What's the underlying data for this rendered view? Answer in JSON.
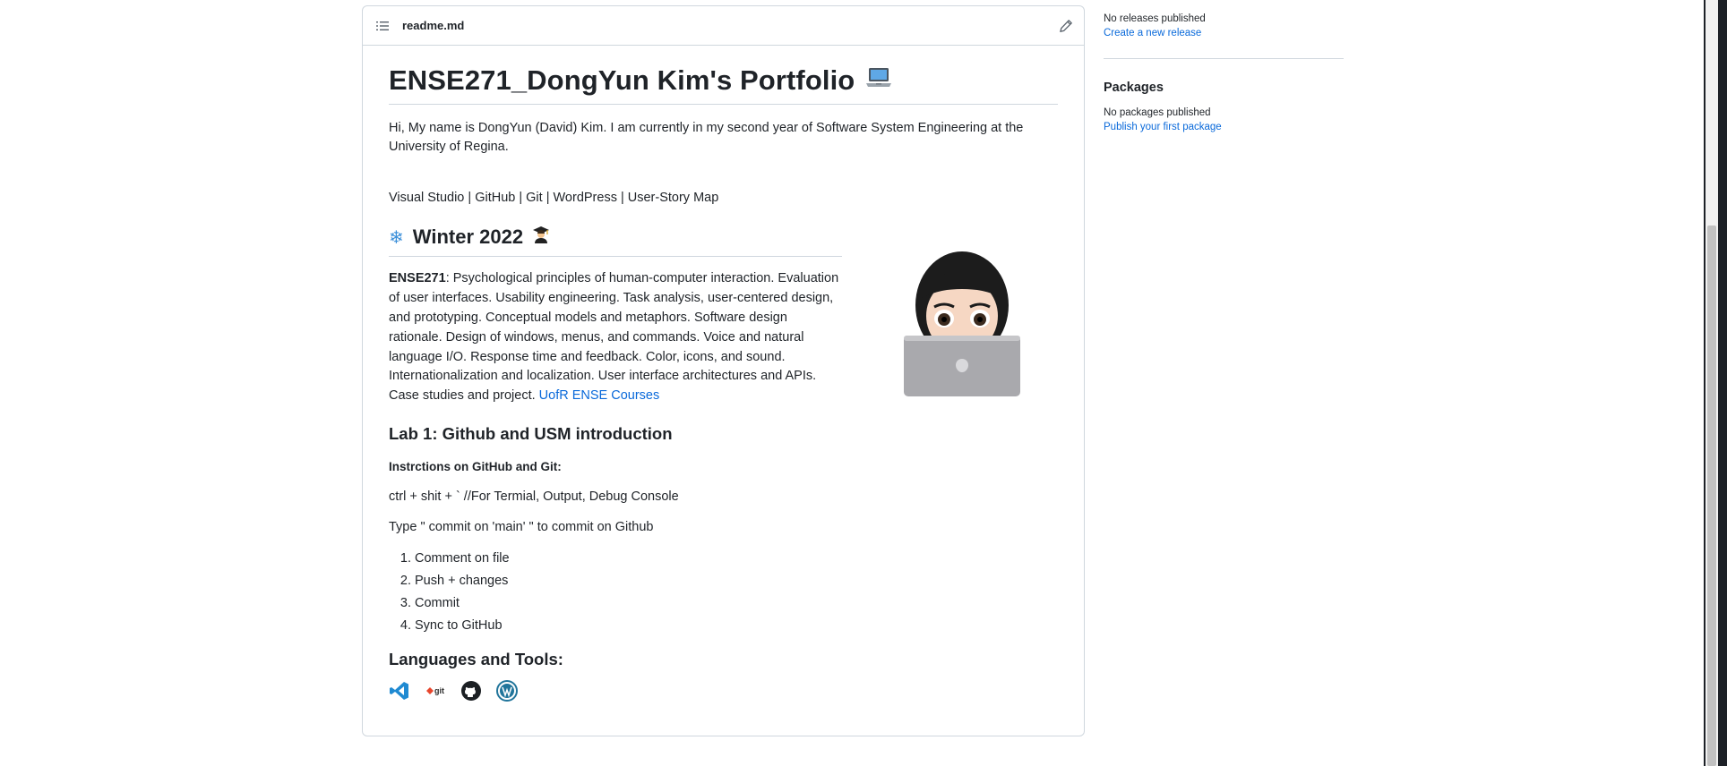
{
  "readme": {
    "file_name": "readme.md",
    "title": "ENSE271_DongYun Kim's Portfolio",
    "intro": "Hi, My name is DongYun (David) Kim. I am currently in my second year of Software System Engineering at the University of Regina.",
    "tools_line": "Visual Studio | GitHub | Git | WordPress | User-Story Map",
    "winter_heading": "Winter 2022",
    "course_code": "ENSE271",
    "course_desc": ": Psychological principles of human-computer interaction. Evaluation of user interfaces. Usability engineering. Task analysis, user-centered design, and prototyping. Conceptual models and metaphors. Software design rationale. Design of windows, menus, and commands. Voice and natural language I/O. Response time and feedback. Color, icons, and sound. Internationalization and localization. User interface architectures and APIs. Case studies and project. ",
    "course_link": "UofR ENSE Courses",
    "lab_heading": "Lab 1: Github and USM introduction",
    "instructions_label": "Instrctions on GitHub and Git:",
    "shortcut_line": "ctrl + shit + ` //For Termial, Output, Debug Console",
    "commit_line": "Type \" commit on 'main' \" to commit on Github",
    "steps": [
      "Comment on file",
      "Push + changes",
      "Commit",
      "Sync to GitHub"
    ],
    "languages_heading": "Languages and Tools:",
    "tool_icons": [
      "vscode-icon",
      "git-icon",
      "github-icon",
      "wordpress-icon"
    ]
  },
  "sidebar": {
    "releases_text": "No releases published",
    "releases_link": "Create a new release",
    "packages_heading": "Packages",
    "packages_text": "No packages published",
    "packages_link": "Publish your first package"
  },
  "colors": {
    "link": "#0969da",
    "border": "#d0d7de",
    "text": "#1f2328"
  }
}
